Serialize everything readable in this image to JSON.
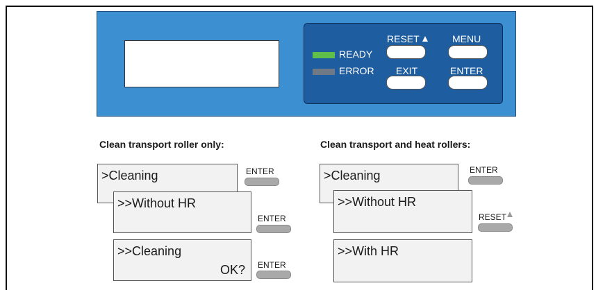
{
  "panel": {
    "led_ready_label": "READY",
    "led_error_label": "ERROR",
    "reset_label": "RESET",
    "menu_label": "MENU",
    "exit_label": "EXIT",
    "enter_label": "ENTER",
    "led_ready_color": "#5fbf4a",
    "led_error_color": "#6f7a86"
  },
  "left_sequence": {
    "heading": "Clean transport roller only:",
    "screen1_text": ">Cleaning",
    "screen1_button": "ENTER",
    "screen2_text": ">>Without HR",
    "screen2_button": "ENTER",
    "screen3_text": ">>Cleaning",
    "screen3_prompt": "OK?",
    "screen3_button": "ENTER"
  },
  "right_sequence": {
    "heading": "Clean transport and heat rollers:",
    "screen1_text": ">Cleaning",
    "screen1_button": "ENTER",
    "screen2_text": ">>Without HR",
    "screen2_button": "RESET",
    "screen3_text": ">>With HR"
  }
}
